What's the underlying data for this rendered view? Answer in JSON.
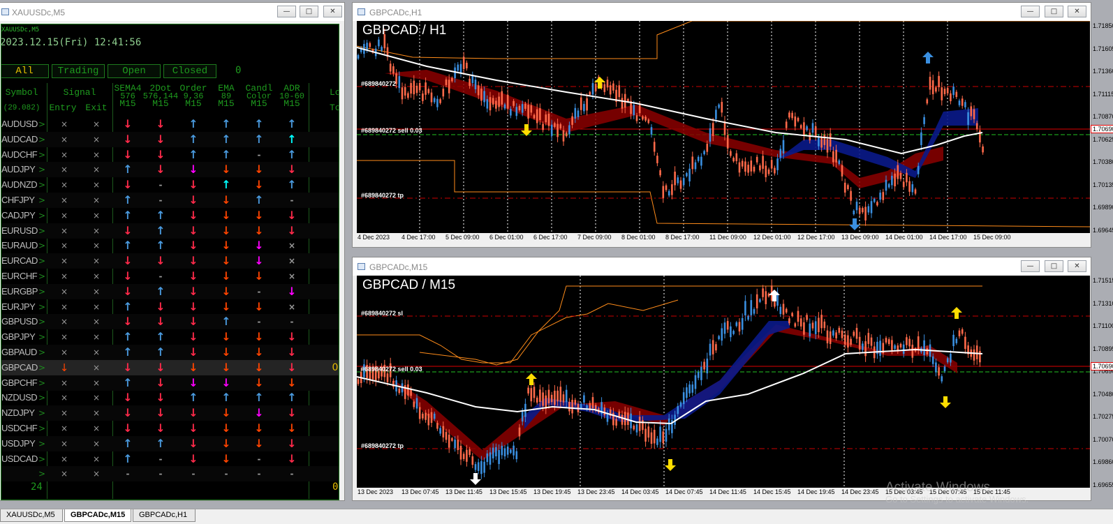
{
  "left_window": {
    "title": "XAUUSDc,M5"
  },
  "panel": {
    "symbol": "XAUUSDc,M5",
    "datetime": "2023.12.15(Fri) 12:41:56",
    "filters": [
      "All",
      "Trading",
      "Open",
      "Closed"
    ],
    "filter_count": "0",
    "headers": {
      "symbol": "Symbol",
      "symbol_sub": "(29.082)",
      "signal": "Signal",
      "entry": "Entry",
      "exit": "Exit",
      "c1": [
        "SEMA4",
        "576",
        "M15"
      ],
      "c2": [
        "2Dot",
        "576,144",
        "M15"
      ],
      "c3": [
        "Order",
        "9,36",
        "M15"
      ],
      "c4": [
        "EMA",
        "89",
        "M15"
      ],
      "c5": [
        "Candl",
        "Color",
        "M15"
      ],
      "c6": [
        "ADR",
        "10-60",
        "M15"
      ],
      "c7": [
        "Lo",
        "To"
      ]
    },
    "rows": [
      {
        "sym": "AUDUSD",
        "entry": "×",
        "exit": "×",
        "c": [
          "↓",
          "↓",
          "↑",
          "↑",
          "↑",
          "↑"
        ],
        "k": [
          "#ff2a4a",
          "#ff2a4a",
          "#4a9ade",
          "#4a9ade",
          "#4a9ade",
          "#4a9ade"
        ],
        "tot": ""
      },
      {
        "sym": "AUDCAD",
        "entry": "×",
        "exit": "×",
        "c": [
          "↓",
          "↓",
          "↑",
          "↑",
          "↑",
          "↑"
        ],
        "k": [
          "#ff2a4a",
          "#ff2a4a",
          "#4a9ade",
          "#4a9ade",
          "#4a9ade",
          "#00ffff"
        ],
        "tot": ""
      },
      {
        "sym": "AUDCHF",
        "entry": "×",
        "exit": "×",
        "c": [
          "↓",
          "↓",
          "↑",
          "↑",
          "-",
          "↑"
        ],
        "k": [
          "#ff2a4a",
          "#ff2a4a",
          "#4a9ade",
          "#4a9ade",
          "#9a9a9a",
          "#4a9ade"
        ],
        "tot": ""
      },
      {
        "sym": "AUDJPY",
        "entry": "×",
        "exit": "×",
        "c": [
          "↑",
          "↓",
          "↓",
          "↓",
          "↓",
          "↓"
        ],
        "k": [
          "#4a9ade",
          "#ff2a4a",
          "#ff00ff",
          "#ff4400",
          "#ff4400",
          "#ff2a4a"
        ],
        "tot": ""
      },
      {
        "sym": "AUDNZD",
        "entry": "×",
        "exit": "×",
        "c": [
          "↓",
          "-",
          "↓",
          "↑",
          "↓",
          "↑"
        ],
        "k": [
          "#ff2a4a",
          "#9a9a9a",
          "#ff2a4a",
          "#00ffff",
          "#ff4400",
          "#4a9ade"
        ],
        "tot": ""
      },
      {
        "sym": "CHFJPY",
        "entry": "×",
        "exit": "×",
        "c": [
          "↑",
          "-",
          "↓",
          "↓",
          "↑",
          "-"
        ],
        "k": [
          "#4a9ade",
          "#9a9a9a",
          "#ff2a4a",
          "#ff4400",
          "#4a9ade",
          "#9a9a9a"
        ],
        "tot": ""
      },
      {
        "sym": "CADJPY",
        "entry": "×",
        "exit": "×",
        "c": [
          "↑",
          "↑",
          "↓",
          "↓",
          "↓",
          "↓"
        ],
        "k": [
          "#4a9ade",
          "#4a9ade",
          "#ff2a4a",
          "#ff4400",
          "#ff4400",
          "#ff2a4a"
        ],
        "tot": ""
      },
      {
        "sym": "EURUSD",
        "entry": "×",
        "exit": "×",
        "c": [
          "↓",
          "↑",
          "↓",
          "↓",
          "↓",
          "↓"
        ],
        "k": [
          "#ff2a4a",
          "#4a9ade",
          "#ff2a4a",
          "#ff4400",
          "#ff4400",
          "#ff2a4a"
        ],
        "tot": ""
      },
      {
        "sym": "EURAUD",
        "entry": "×",
        "exit": "×",
        "c": [
          "↑",
          "↑",
          "↓",
          "↓",
          "↓",
          "×"
        ],
        "k": [
          "#4a9ade",
          "#4a9ade",
          "#ff2a4a",
          "#ff4400",
          "#ff00ff",
          "#9a9a9a"
        ],
        "tot": ""
      },
      {
        "sym": "EURCAD",
        "entry": "×",
        "exit": "×",
        "c": [
          "↓",
          "↓",
          "↓",
          "↓",
          "↓",
          "×"
        ],
        "k": [
          "#ff2a4a",
          "#ff2a4a",
          "#ff2a4a",
          "#ff4400",
          "#ff00ff",
          "#9a9a9a"
        ],
        "tot": ""
      },
      {
        "sym": "EURCHF",
        "entry": "×",
        "exit": "×",
        "c": [
          "↓",
          "-",
          "↓",
          "↓",
          "↓",
          "×"
        ],
        "k": [
          "#ff2a4a",
          "#9a9a9a",
          "#ff2a4a",
          "#ff4400",
          "#ff4400",
          "#9a9a9a"
        ],
        "tot": ""
      },
      {
        "sym": "EURGBP",
        "entry": "×",
        "exit": "×",
        "c": [
          "↓",
          "↑",
          "↓",
          "↓",
          "-",
          "↓"
        ],
        "k": [
          "#ff2a4a",
          "#4a9ade",
          "#ff2a4a",
          "#ff4400",
          "#9a9a9a",
          "#ff00ff"
        ],
        "tot": ""
      },
      {
        "sym": "EURJPY",
        "entry": "×",
        "exit": "×",
        "c": [
          "↑",
          "↓",
          "↓",
          "↓",
          "↓",
          "×"
        ],
        "k": [
          "#4a9ade",
          "#ff2a4a",
          "#ff2a4a",
          "#ff4400",
          "#ff4400",
          "#9a9a9a"
        ],
        "tot": ""
      },
      {
        "sym": "GBPUSD",
        "entry": "×",
        "exit": "×",
        "c": [
          "↓",
          "↓",
          "↓",
          "↑",
          "-",
          "-"
        ],
        "k": [
          "#ff2a4a",
          "#ff2a4a",
          "#ff2a4a",
          "#4a9ade",
          "#9a9a9a",
          "#9a9a9a"
        ],
        "tot": ""
      },
      {
        "sym": "GBPJPY",
        "entry": "×",
        "exit": "×",
        "c": [
          "↑",
          "↑",
          "↓",
          "↓",
          "↓",
          "↓"
        ],
        "k": [
          "#4a9ade",
          "#4a9ade",
          "#ff2a4a",
          "#ff4400",
          "#ff4400",
          "#ff2a4a"
        ],
        "tot": ""
      },
      {
        "sym": "GBPAUD",
        "entry": "×",
        "exit": "×",
        "c": [
          "↑",
          "↑",
          "↓",
          "↓",
          "↓",
          "↓"
        ],
        "k": [
          "#4a9ade",
          "#4a9ade",
          "#ff2a4a",
          "#ff4400",
          "#ff4400",
          "#ff2a4a"
        ],
        "tot": ""
      },
      {
        "sym": "GBPCAD",
        "entry": "↓",
        "exit": "×",
        "c": [
          "↓",
          "↓",
          "↓",
          "↓",
          "↓",
          "↓"
        ],
        "k": [
          "#ff2a4a",
          "#ff2a4a",
          "#ff4400",
          "#ff4400",
          "#ff4400",
          "#ff2a4a"
        ],
        "tot": "0",
        "ek": "#ff4400"
      },
      {
        "sym": "GBPCHF",
        "entry": "×",
        "exit": "×",
        "c": [
          "↑",
          "↓",
          "↓",
          "↓",
          "↓",
          "↓"
        ],
        "k": [
          "#4a9ade",
          "#ff2a4a",
          "#ff00ff",
          "#ff00ff",
          "#ff4400",
          "#ff4400"
        ],
        "tot": ""
      },
      {
        "sym": "NZDUSD",
        "entry": "×",
        "exit": "×",
        "c": [
          "↓",
          "↓",
          "↑",
          "↑",
          "↑",
          "↑"
        ],
        "k": [
          "#ff2a4a",
          "#ff2a4a",
          "#4a9ade",
          "#4a9ade",
          "#4a9ade",
          "#4a9ade"
        ],
        "tot": ""
      },
      {
        "sym": "NZDJPY",
        "entry": "×",
        "exit": "×",
        "c": [
          "↓",
          "↓",
          "↓",
          "↓",
          "↓",
          "↓"
        ],
        "k": [
          "#ff2a4a",
          "#ff2a4a",
          "#ff2a4a",
          "#ff4400",
          "#ff00ff",
          "#ff2a4a"
        ],
        "tot": ""
      },
      {
        "sym": "USDCHF",
        "entry": "×",
        "exit": "×",
        "c": [
          "↓",
          "↓",
          "↓",
          "↓",
          "↓",
          "↓"
        ],
        "k": [
          "#ff2a4a",
          "#ff2a4a",
          "#ff2a4a",
          "#ff4400",
          "#ff4400",
          "#ff4400"
        ],
        "tot": ""
      },
      {
        "sym": "USDJPY",
        "entry": "×",
        "exit": "×",
        "c": [
          "↑",
          "↑",
          "↓",
          "↓",
          "↓",
          "↓"
        ],
        "k": [
          "#4a9ade",
          "#4a9ade",
          "#ff2a4a",
          "#ff4400",
          "#ff4400",
          "#ff2a4a"
        ],
        "tot": ""
      },
      {
        "sym": "USDCAD",
        "entry": "×",
        "exit": "×",
        "c": [
          "↑",
          "-",
          "↓",
          "↓",
          "-",
          "↓"
        ],
        "k": [
          "#4a9ade",
          "#9a9a9a",
          "#ff2a4a",
          "#ff4400",
          "#9a9a9a",
          "#ff2a4a"
        ],
        "tot": ""
      },
      {
        "sym": "",
        "entry": "×",
        "exit": "×",
        "c": [
          "-",
          "-",
          "-",
          "-",
          "-",
          "-"
        ],
        "k": [
          "#9a9a9a",
          "#9a9a9a",
          "#9a9a9a",
          "#9a9a9a",
          "#9a9a9a",
          "#9a9a9a"
        ],
        "tot": ""
      }
    ],
    "footer_count": "24",
    "footer_total": "0"
  },
  "chart_h1": {
    "window_title": "GBPCADc,H1",
    "label": "GBPCAD / H1",
    "prices": [
      "1.71850",
      "1.71605",
      "1.71360",
      "1.71115",
      "1.70870",
      "1.70625",
      "1.70380",
      "1.70135",
      "1.69890",
      "1.69645"
    ],
    "current_price": "1.70690",
    "dates": [
      "4 Dec 2023",
      "4 Dec 17:00",
      "5 Dec 09:00",
      "6 Dec 01:00",
      "6 Dec 17:00",
      "7 Dec 09:00",
      "8 Dec 01:00",
      "8 Dec 17:00",
      "11 Dec 09:00",
      "12 Dec 01:00",
      "12 Dec 17:00",
      "13 Dec 09:00",
      "14 Dec 01:00",
      "14 Dec 17:00",
      "15 Dec 09:00"
    ],
    "order_labels": [
      "#689840272",
      "#689840272 sell 0.03",
      "#689840272 tp"
    ]
  },
  "chart_m15": {
    "window_title": "GBPCADc,M15",
    "label": "GBPCAD / M15",
    "prices": [
      "1.71515",
      "1.71310",
      "1.71100",
      "1.70895",
      "1.70690",
      "1.70480",
      "1.70275",
      "1.70070",
      "1.69860",
      "1.69655"
    ],
    "current_price": "1.70690",
    "dates": [
      "13 Dec 2023",
      "13 Dec 07:45",
      "13 Dec 11:45",
      "13 Dec 15:45",
      "13 Dec 19:45",
      "13 Dec 23:45",
      "14 Dec 03:45",
      "14 Dec 07:45",
      "14 Dec 11:45",
      "14 Dec 15:45",
      "14 Dec 19:45",
      "14 Dec 23:45",
      "15 Dec 03:45",
      "15 Dec 07:45",
      "15 Dec 11:45"
    ],
    "order_labels": [
      "#689840272 sl",
      "#689840272 sell 0.03",
      "#689840272 tp"
    ]
  },
  "tabs": [
    "XAUUSDc,M5",
    "GBPCADc,M15",
    "GBPCADc,H1"
  ],
  "watermark": {
    "line1": "Activate Windows",
    "line2": "Go to Settings to activate Windows."
  },
  "colors": {
    "bull": "#3a8fe0",
    "bear": "#ff6a4a",
    "ribbon_bear": "#8b0000",
    "ribbon_bull": "#0a1a8a",
    "ema": "#ffffff",
    "adr": "#ff8c1a",
    "sl_tp": "#cc0000",
    "grid": "#ffffff"
  }
}
